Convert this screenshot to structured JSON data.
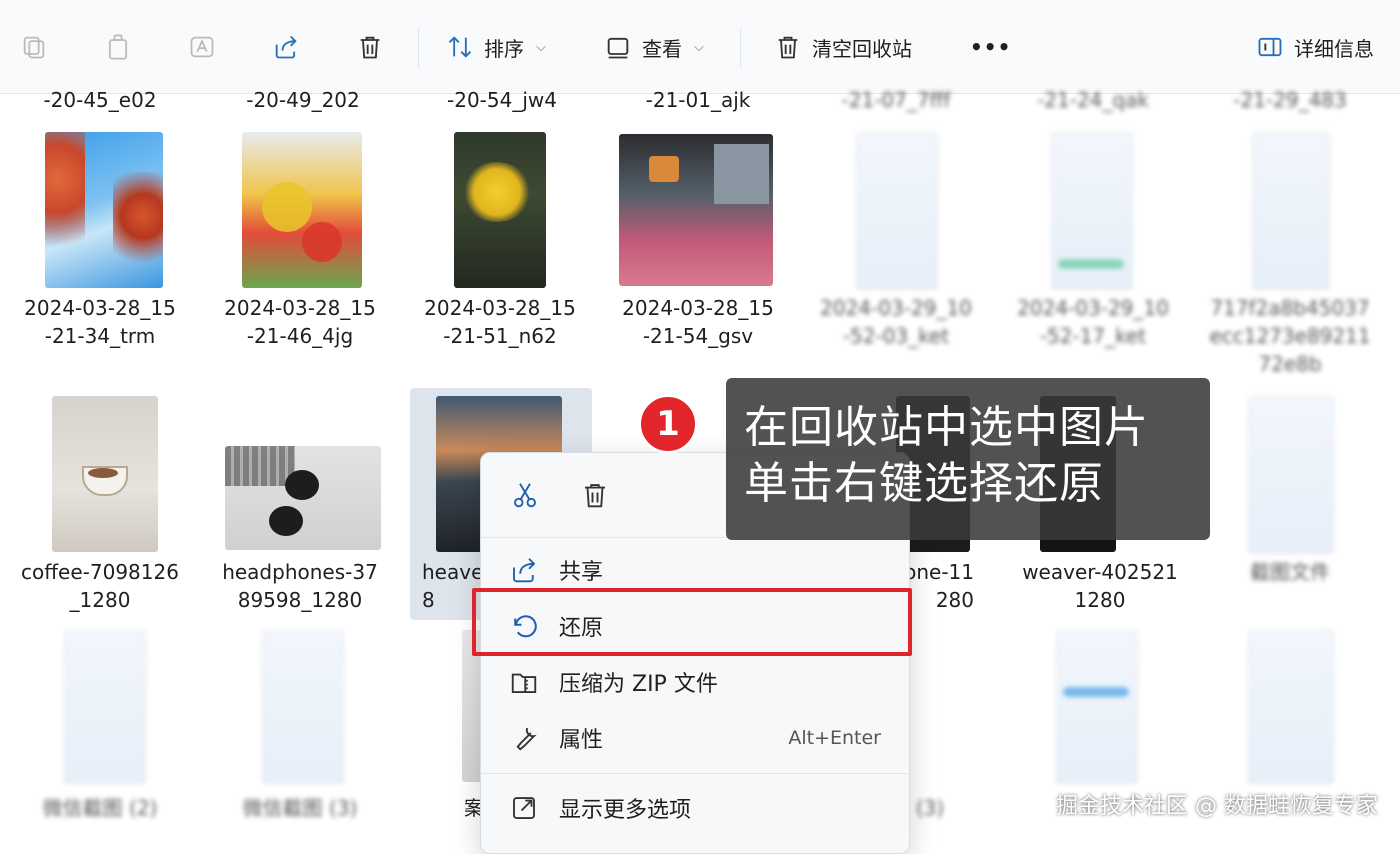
{
  "toolbar": {
    "sort_label": "排序",
    "view_label": "查看",
    "empty_bin_label": "清空回收站",
    "more_label": "•••",
    "details_label": "详细信息"
  },
  "top_row_partial": [
    "-20-45_e02",
    "-20-49_202",
    "-20-54_jw4",
    "-21-01_ajk",
    "-21-07_7fff",
    "-21-24_qak",
    "-21-29_483"
  ],
  "files": {
    "row2": [
      {
        "name": "2024-03-28_15\n-21-34_trm"
      },
      {
        "name": "2024-03-28_15\n-21-46_4jg"
      },
      {
        "name": "2024-03-28_15\n-21-51_n62"
      },
      {
        "name": "2024-03-28_15\n-21-54_gsv"
      },
      {
        "name": "2024-03-29_10\n-52-03_ket"
      },
      {
        "name": "2024-03-29_10\n-52-17_ket"
      },
      {
        "name": "717f2a8b45037\necc1273e89211\n72e8b"
      }
    ],
    "row3": [
      {
        "name": "coffee-7098126\n_1280"
      },
      {
        "name": "headphones-37\n89598_1280"
      },
      {
        "name": "heave\n8"
      },
      {
        "name": "one-11\n280"
      },
      {
        "name": "weaver-402521\n1280"
      },
      {
        "name": "截图文件"
      }
    ],
    "row4": [
      "微信截图 (2)",
      "微信截图 (3)",
      "案",
      "(3)"
    ]
  },
  "context_menu": {
    "share": "共享",
    "restore": "还原",
    "compress": "压缩为 ZIP 文件",
    "properties": "属性",
    "properties_shortcut": "Alt+Enter",
    "more_options": "显示更多选项"
  },
  "callout": {
    "badge": "1",
    "text": "在回收站中选中图片\n单击右键选择还原"
  },
  "watermark": "掘金技术社区 @ 数据蛙恢复专家"
}
